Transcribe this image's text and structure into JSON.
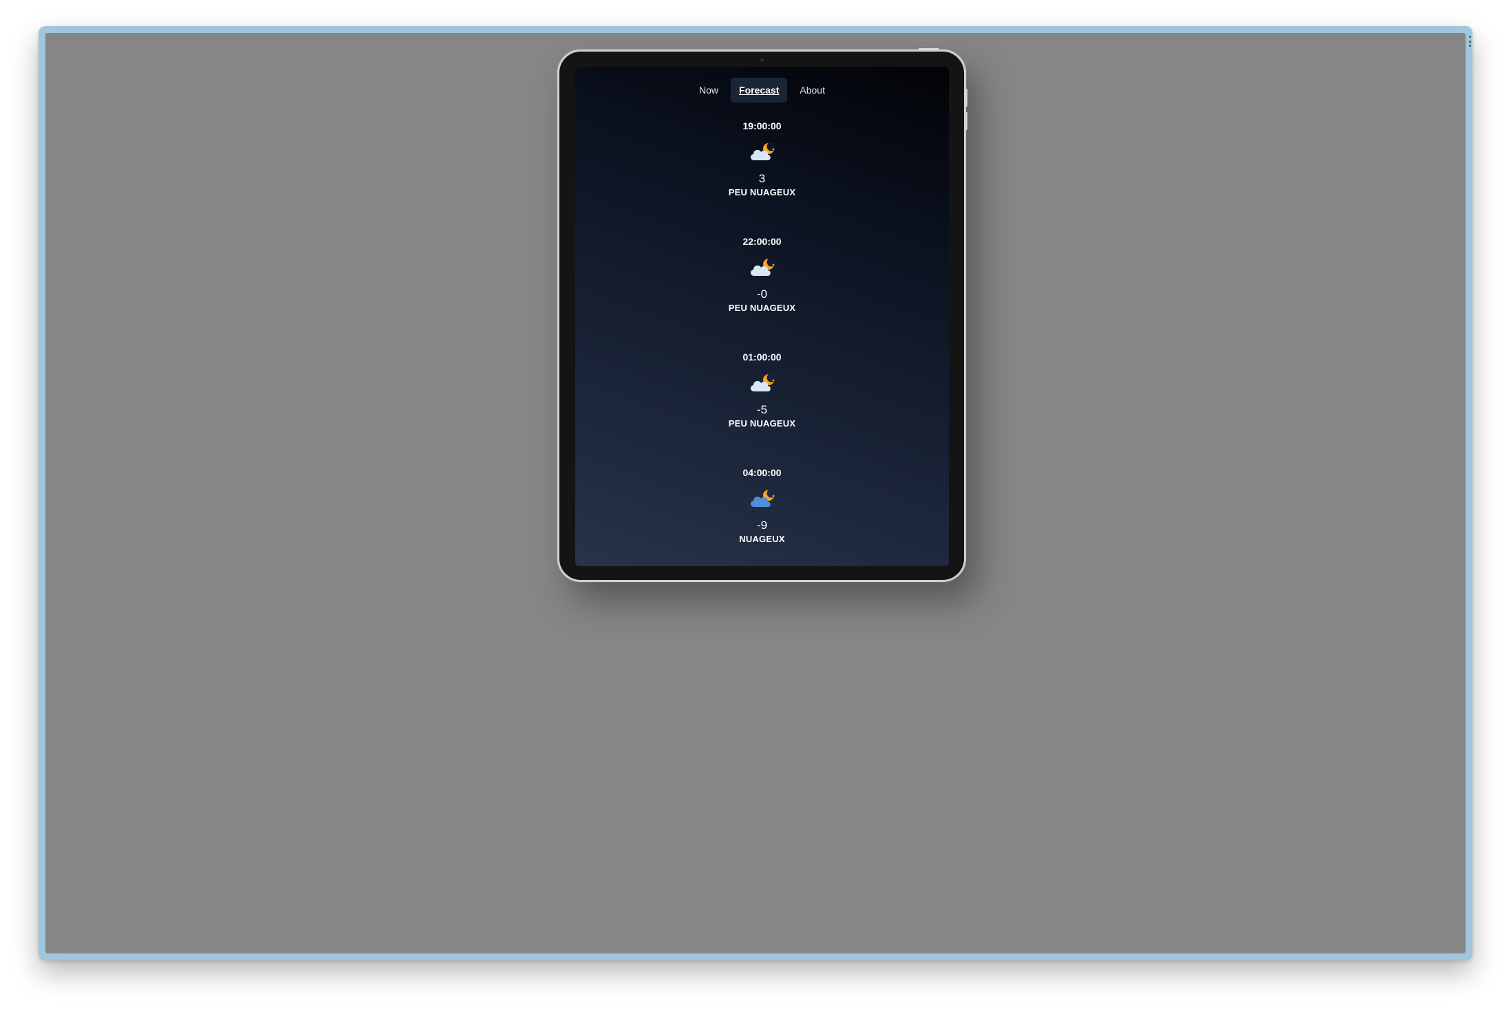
{
  "nav": {
    "tabs": [
      {
        "label": "Now",
        "active": false
      },
      {
        "label": "Forecast",
        "active": true
      },
      {
        "label": "About",
        "active": false
      }
    ]
  },
  "forecast": [
    {
      "time": "19:00:00",
      "icon": "cloud-moon-icon",
      "temp": "3",
      "description": "PEU NUAGEUX"
    },
    {
      "time": "22:00:00",
      "icon": "cloud-moon-icon",
      "temp": "-0",
      "description": "PEU NUAGEUX"
    },
    {
      "time": "01:00:00",
      "icon": "cloud-moon-icon",
      "temp": "-5",
      "description": "PEU NUAGEUX"
    },
    {
      "time": "04:00:00",
      "icon": "cloud-moon-icon-blue",
      "temp": "-9",
      "description": "NUAGEUX"
    }
  ],
  "colors": {
    "frame": "#9fc6da",
    "canvas": "#868686",
    "moon": "#f5a623",
    "cloud_light": "#d8e6f5",
    "cloud_blue": "#4f8fd8"
  }
}
